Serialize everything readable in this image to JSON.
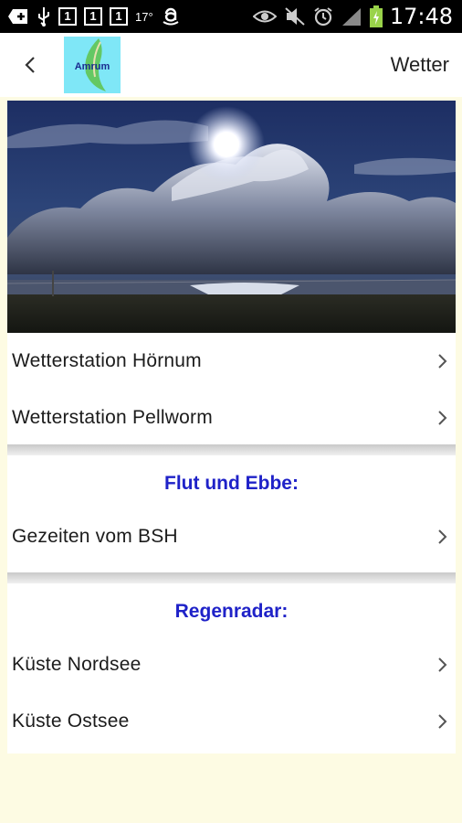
{
  "status_bar": {
    "box1": "1",
    "box2": "1",
    "box3": "1",
    "temp": "17°",
    "time": "17:48"
  },
  "app_bar": {
    "logo_text": "Amrum",
    "title": "Wetter"
  },
  "group1": {
    "items": [
      {
        "label": "Wetterstation Hörnum"
      },
      {
        "label": "Wetterstation Pellworm"
      }
    ]
  },
  "group2": {
    "heading": "Flut und Ebbe:",
    "items": [
      {
        "label": "Gezeiten vom BSH"
      }
    ]
  },
  "group3": {
    "heading": "Regenradar:",
    "items": [
      {
        "label": "Küste Nordsee"
      },
      {
        "label": "Küste Ostsee"
      }
    ]
  },
  "colors": {
    "background": "#fdfbe3",
    "heading": "#1f22c8",
    "logo_bg": "#7fe7f7"
  }
}
